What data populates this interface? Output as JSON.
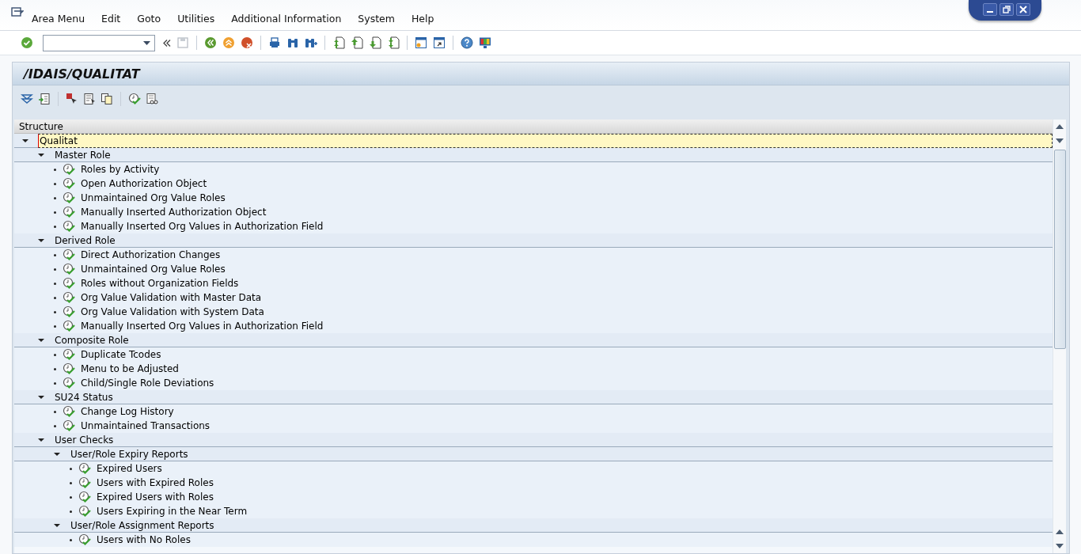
{
  "menu": [
    "Area Menu",
    "Edit",
    "Goto",
    "Utilities",
    "Additional Information",
    "System",
    "Help"
  ],
  "title": "/IDAIS/QUALITAT",
  "tree": {
    "header": "Structure",
    "items": [
      {
        "label": "Qualitat",
        "kind": "folder",
        "expanded": true,
        "selected": true,
        "children": [
          {
            "label": "Master Role",
            "kind": "folder",
            "expanded": true,
            "selected": false,
            "children": [
              {
                "label": "Roles by Activity",
                "kind": "report",
                "selected": false
              },
              {
                "label": "Open Authorization Object",
                "kind": "report",
                "selected": false
              },
              {
                "label": "Unmaintained Org Value Roles",
                "kind": "report",
                "selected": false
              },
              {
                "label": "Manually Inserted Authorization Object",
                "kind": "report",
                "selected": false
              },
              {
                "label": "Manually Inserted Org Values in Authorization Field",
                "kind": "report",
                "selected": false
              }
            ]
          },
          {
            "label": "Derived Role",
            "kind": "folder",
            "expanded": true,
            "selected": false,
            "children": [
              {
                "label": "Direct Authorization Changes",
                "kind": "report",
                "selected": false
              },
              {
                "label": "Unmaintained Org Value Roles",
                "kind": "report",
                "selected": false
              },
              {
                "label": "Roles without Organization Fields",
                "kind": "report",
                "selected": false
              },
              {
                "label": "Org Value Validation with Master Data",
                "kind": "report",
                "selected": false
              },
              {
                "label": "Org Value Validation with System Data",
                "kind": "report",
                "selected": false
              },
              {
                "label": "Manually Inserted Org Values in Authorization Field",
                "kind": "report",
                "selected": false
              }
            ]
          },
          {
            "label": "Composite Role",
            "kind": "folder",
            "expanded": true,
            "selected": false,
            "children": [
              {
                "label": "Duplicate Tcodes",
                "kind": "report",
                "selected": false
              },
              {
                "label": "Menu to be Adjusted",
                "kind": "report",
                "selected": false
              },
              {
                "label": "Child/Single Role Deviations",
                "kind": "report",
                "selected": false
              }
            ]
          },
          {
            "label": "SU24 Status",
            "kind": "folder",
            "expanded": true,
            "selected": false,
            "children": [
              {
                "label": "Change Log History",
                "kind": "report",
                "selected": false
              },
              {
                "label": "Unmaintained Transactions",
                "kind": "report",
                "selected": false
              }
            ]
          },
          {
            "label": "User Checks",
            "kind": "folder",
            "expanded": true,
            "selected": false,
            "children": [
              {
                "label": "User/Role Expiry Reports",
                "kind": "folder",
                "expanded": true,
                "selected": false,
                "children": [
                  {
                    "label": "Expired Users",
                    "kind": "report",
                    "selected": false
                  },
                  {
                    "label": "Users with Expired Roles",
                    "kind": "report",
                    "selected": false
                  },
                  {
                    "label": "Expired Users with Roles",
                    "kind": "report",
                    "selected": false
                  },
                  {
                    "label": "Users Expiring in the Near Term",
                    "kind": "report",
                    "selected": false
                  }
                ]
              },
              {
                "label": "User/Role Assignment Reports",
                "kind": "folder",
                "expanded": true,
                "selected": false,
                "children": [
                  {
                    "label": "Users with No Roles",
                    "kind": "report",
                    "selected": false
                  }
                ]
              }
            ]
          }
        ]
      }
    ]
  }
}
